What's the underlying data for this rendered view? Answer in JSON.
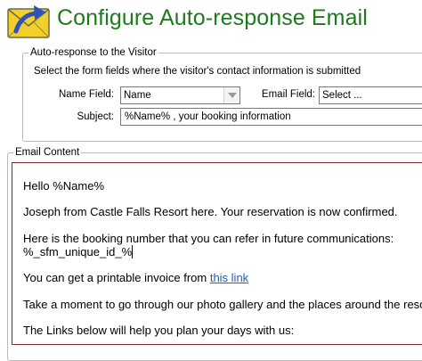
{
  "header": {
    "title": "Configure Auto-response Email"
  },
  "visitor_section": {
    "legend": "Auto-response to the Visitor",
    "description": "Select the form fields where the visitor's contact information is  submitted",
    "name_field": {
      "label": "Name Field:",
      "value": "Name"
    },
    "email_field": {
      "label": "Email Field:",
      "value": "Select ..."
    },
    "subject": {
      "label": "Subject:",
      "value": "%Name% , your booking information"
    }
  },
  "content_section": {
    "legend": "Email Content",
    "paragraphs": [
      "Hello %Name%",
      "Joseph from Castle Falls Resort here. Your reservation is now confirmed.",
      "Here is the booking number that you can refer in future communications:",
      "%_sfm_unique_id_%",
      "You can get a printable invoice from ",
      "Take a moment to go through our photo gallery and the places around the resort.",
      "The Links below will help you plan your days with us:"
    ],
    "link_text": "this link"
  },
  "colors": {
    "title": "#1e7a1e",
    "editor_border": "#8b2230",
    "link": "#1f5fbf"
  },
  "icons": {
    "header": "envelope-arrow-icon"
  }
}
